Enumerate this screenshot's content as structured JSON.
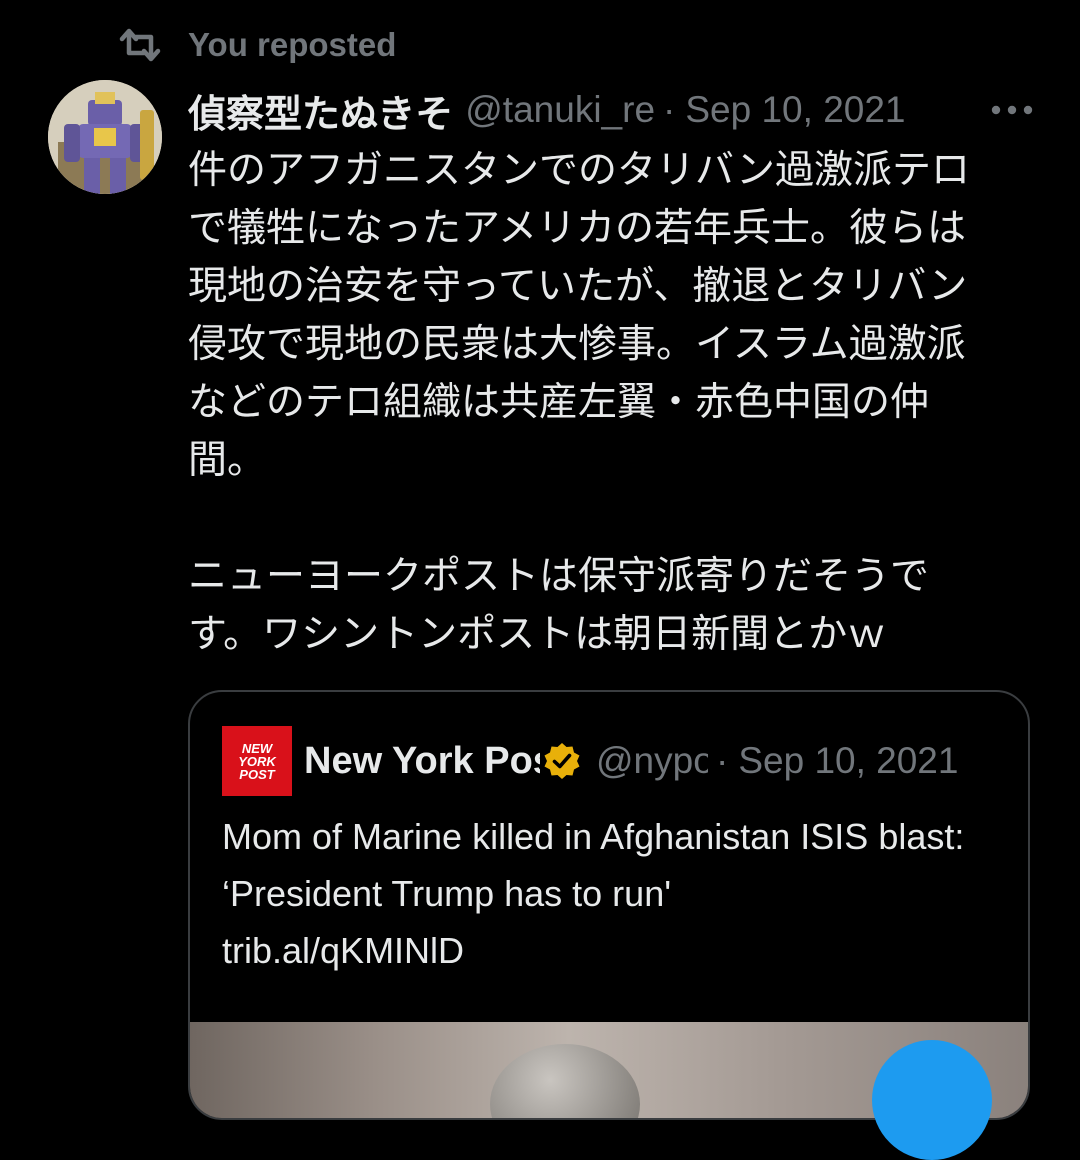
{
  "repost": {
    "label": "You reposted",
    "icon": "repost-icon"
  },
  "tweet": {
    "display_name": "偵察型たぬきそ",
    "handle": "@tanuki_re",
    "separator": "·",
    "date": "Sep 10, 2021",
    "more_icon": "more-icon",
    "body": "件のアフガニスタンでのタリバン過激派テロ\nで犠牲になったアメリカの若年兵士。彼らは\n現地の治安を守っていたが、撤退とタリバン\n侵攻で現地の民衆は大惨事。イスラム過激派\nなどのテロ組織は共産左翼・赤色中国の仲\n間。\n\nニューヨークポストは保守派寄りだそうで\nす。ワシントンポストは朝日新聞とかｗ"
  },
  "quote": {
    "logo_lines": [
      "NEW",
      "YORK",
      "POST"
    ],
    "display_name": "New York Post",
    "handle": "@nypost",
    "separator": "·",
    "date": "Sep 10, 2021",
    "text": "Mom of Marine killed in Afghanistan ISIS blast: ‘President Trump has to run'",
    "link": "trib.al/qKMINlD"
  },
  "colors": {
    "background": "#000000",
    "text": "#e7e9ea",
    "muted": "#71767b",
    "accent": "#1d9bf0",
    "verified": "#e8b00a",
    "logo": "#d9111a"
  }
}
